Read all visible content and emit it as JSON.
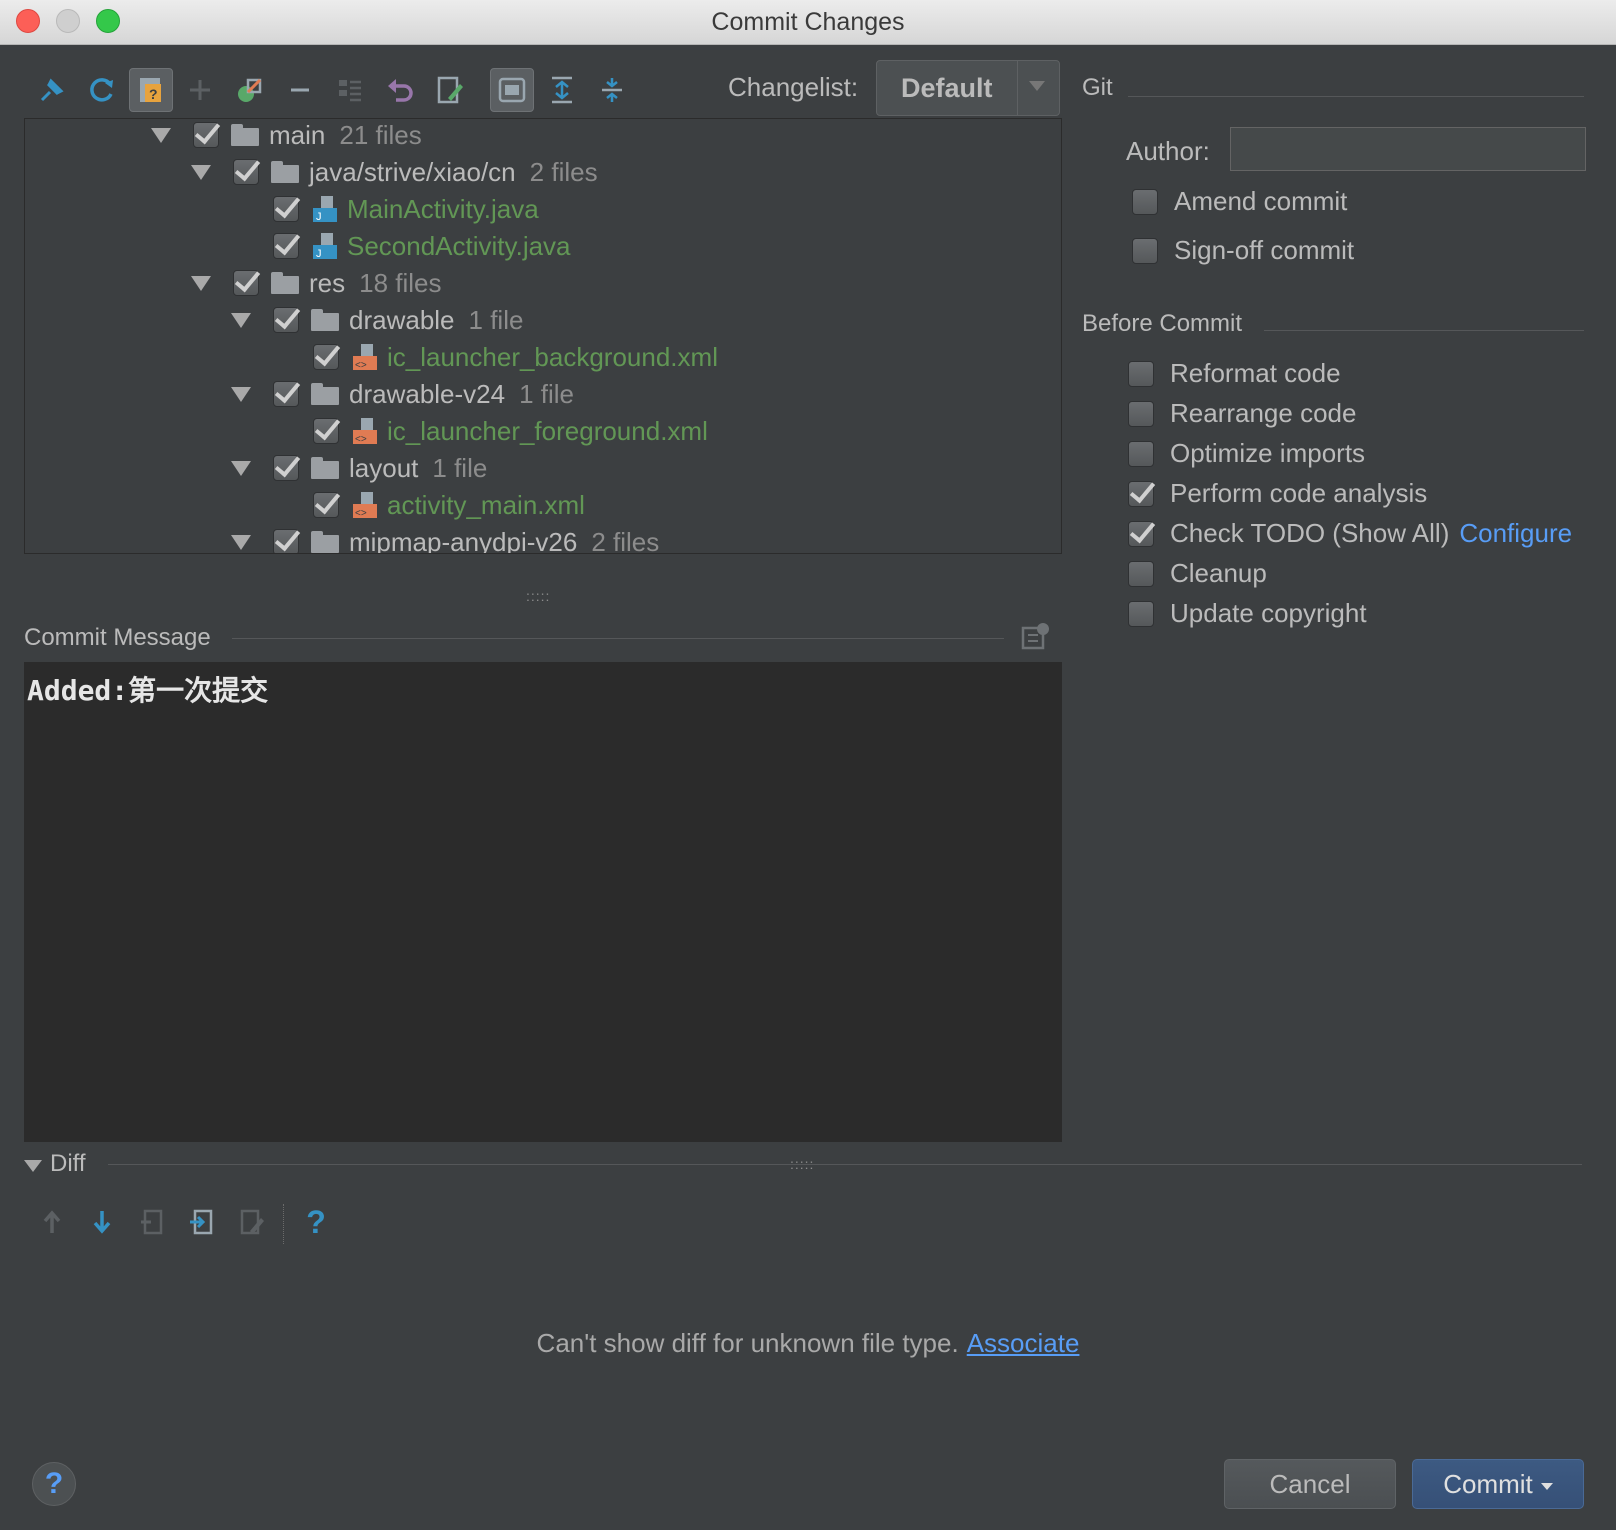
{
  "window": {
    "title": "Commit Changes"
  },
  "toolbar": {
    "changelist_label": "Changelist:",
    "changelist_value": "Default",
    "buttons": [
      "pin-icon",
      "refresh-icon",
      "unversioned-icon",
      "add-icon",
      "move-icon",
      "remove-icon",
      "group-icon",
      "rollback-icon",
      "edit-source-icon",
      "show-diff-icon",
      "expand-all-icon",
      "collapse-all-icon"
    ]
  },
  "tree": {
    "rows": [
      {
        "name": "main",
        "count": "21 files",
        "type": "folder",
        "level": 0,
        "checked": true,
        "expanded": true
      },
      {
        "name": "java/strive/xiao/cn",
        "count": "2 files",
        "type": "folder",
        "level": 1,
        "checked": true,
        "expanded": true
      },
      {
        "name": "MainActivity.java",
        "type": "java",
        "level": 2,
        "checked": true
      },
      {
        "name": "SecondActivity.java",
        "type": "java",
        "level": 2,
        "checked": true
      },
      {
        "name": "res",
        "count": "18 files",
        "type": "folder",
        "level": 1,
        "checked": true,
        "expanded": true
      },
      {
        "name": "drawable",
        "count": "1 file",
        "type": "folder",
        "level": 2,
        "checked": true,
        "expanded": true
      },
      {
        "name": "ic_launcher_background.xml",
        "type": "xml",
        "level": 3,
        "checked": true
      },
      {
        "name": "drawable-v24",
        "count": "1 file",
        "type": "folder",
        "level": 2,
        "checked": true,
        "expanded": true
      },
      {
        "name": "ic_launcher_foreground.xml",
        "type": "xml",
        "level": 3,
        "checked": true
      },
      {
        "name": "layout",
        "count": "1 file",
        "type": "folder",
        "level": 2,
        "checked": true,
        "expanded": true
      },
      {
        "name": "activity_main.xml",
        "type": "xml",
        "level": 3,
        "checked": true
      },
      {
        "name": "mipmap-anydpi-v26",
        "count": "2 files",
        "type": "folder",
        "level": 2,
        "checked": true,
        "expanded": true
      }
    ]
  },
  "commit_message": {
    "label": "Commit Message",
    "text": "Added:第一次提交"
  },
  "git": {
    "label": "Git",
    "author_label": "Author:",
    "author_value": "",
    "amend_label": "Amend commit",
    "signoff_label": "Sign-off commit"
  },
  "before_commit": {
    "label": "Before Commit",
    "options": [
      {
        "label": "Reformat code",
        "checked": false
      },
      {
        "label": "Rearrange code",
        "checked": false
      },
      {
        "label": "Optimize imports",
        "checked": false
      },
      {
        "label": "Perform code analysis",
        "checked": true
      },
      {
        "label": "Check TODO (Show All)",
        "checked": true,
        "link": "Configure"
      },
      {
        "label": "Cleanup",
        "checked": false
      },
      {
        "label": "Update copyright",
        "checked": false
      }
    ]
  },
  "diff": {
    "label": "Diff",
    "message": "Can't show diff for unknown file type.",
    "link": "Associate"
  },
  "buttons": {
    "cancel": "Cancel",
    "commit": "Commit",
    "help": "?"
  },
  "colors": {
    "background": "#3c3f41",
    "added_file": "#629755",
    "link": "#589df6",
    "commit_button": "#365077"
  }
}
